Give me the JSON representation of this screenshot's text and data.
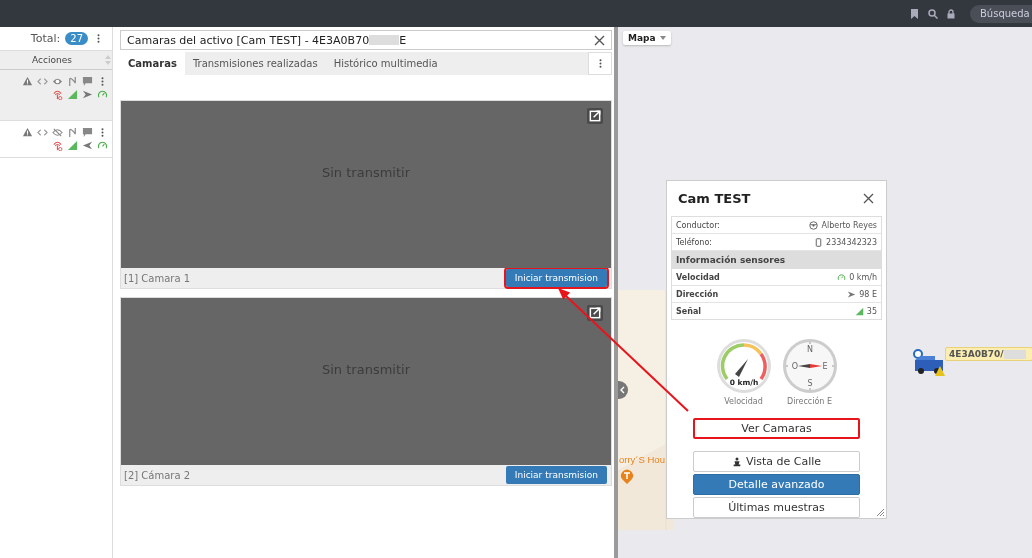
{
  "top_bar": {
    "search": {
      "placeholder": "Búsqueda"
    }
  },
  "asset_list": {
    "total_label": "Total:",
    "total_count": "27",
    "column": "Acciones",
    "rows": [
      {
        "selected": true,
        "visible": true,
        "pointing_left": false
      },
      {
        "selected": false,
        "visible": false,
        "pointing_left": true
      }
    ]
  },
  "camera_panel": {
    "title": "Camaras del activo [Cam TEST] - 4E3A0B70",
    "title_tail": "E",
    "tabs": [
      {
        "label": "Camaras",
        "selected": true
      },
      {
        "label": "Transmisiones realizadas",
        "selected": false
      },
      {
        "label": "Histórico multimedia",
        "selected": false
      }
    ],
    "cameras": [
      {
        "status": "Sin transmitir",
        "caption": "[1] Camara 1",
        "button": "Iniciar transmision",
        "highlighted": true
      },
      {
        "status": "Sin transmitir",
        "caption": "[2] Cámara 2",
        "button": "Iniciar transmision",
        "highlighted": false
      }
    ]
  },
  "map": {
    "layer_button": "Mapa",
    "poi_label": "orry´S Hou",
    "vehicle_label": "4E3A0B70/",
    "popup": {
      "title": "Cam TEST",
      "info": [
        {
          "label": "Conductor:",
          "value": "Alberto Reyes",
          "kind": "driver"
        },
        {
          "label": "Teléfono:",
          "value": "2334342323",
          "kind": "phone"
        }
      ],
      "section": "Información sensores",
      "sensors": [
        {
          "label": "Velocidad",
          "value": "0 km/h",
          "kind": "speed"
        },
        {
          "label": "Dirección",
          "value": "98 E",
          "kind": "heading"
        },
        {
          "label": "Señal",
          "value": "35",
          "kind": "signal"
        }
      ],
      "gauges": [
        {
          "kind": "speed",
          "reading": "0 km/h",
          "label": "Velocidad"
        },
        {
          "kind": "compass",
          "cardinals": [
            "N",
            "E",
            "S",
            "O"
          ],
          "label": "Dirección E"
        }
      ],
      "buttons": [
        {
          "label": "Ver Camaras",
          "kind": "plain",
          "highlighted": true
        },
        {
          "label": "Vista de Calle",
          "kind": "street",
          "highlighted": false
        },
        {
          "label": "Detalle avanzado",
          "kind": "primary",
          "highlighted": false
        },
        {
          "label": "Últimas muestras",
          "kind": "plain",
          "highlighted": false
        }
      ]
    }
  }
}
